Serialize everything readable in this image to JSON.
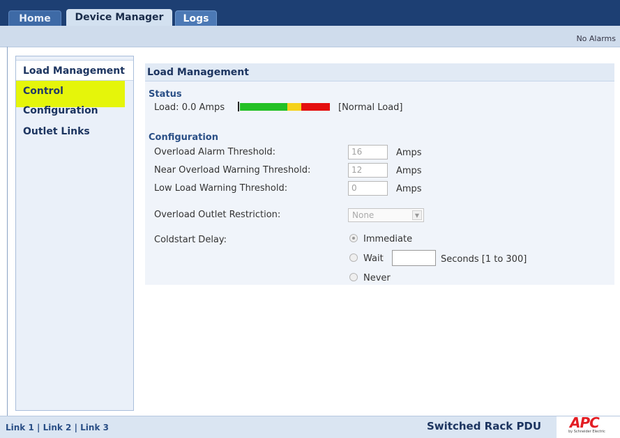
{
  "tabs": [
    {
      "label": "Home"
    },
    {
      "label": "Device Manager",
      "active": true
    },
    {
      "label": "Logs"
    }
  ],
  "alarm_status": "No Alarms",
  "sidebar": {
    "items": [
      {
        "label": "Load Management",
        "selected": true
      },
      {
        "label": "Control",
        "highlighted": true
      },
      {
        "label": "Configuration"
      },
      {
        "label": "Outlet Links"
      }
    ]
  },
  "content": {
    "title": "Load Management",
    "status": {
      "heading": "Status",
      "load_label": "Load: 0.0 Amps",
      "load_state": "[Normal Load]"
    },
    "configuration": {
      "heading": "Configuration",
      "overload_alarm": {
        "label": "Overload Alarm Threshold:",
        "value": "16",
        "unit": "Amps"
      },
      "near_overload": {
        "label": "Near Overload Warning Threshold:",
        "value": "12",
        "unit": "Amps"
      },
      "low_load": {
        "label": "Low Load Warning Threshold:",
        "value": "0",
        "unit": "Amps"
      },
      "outlet_restriction": {
        "label": "Overload Outlet Restriction:",
        "value": "None"
      },
      "coldstart": {
        "label": "Coldstart Delay:",
        "options": [
          "Immediate",
          "Wait",
          "Never"
        ],
        "selected": "Immediate",
        "wait_suffix": "Seconds [1 to 300]"
      }
    }
  },
  "footer": {
    "links": [
      "Link 1",
      "Link 2",
      "Link 3"
    ],
    "separator": "|",
    "product": "Switched Rack PDU",
    "logo": "APC",
    "logo_sub": "by Schneider Electric"
  },
  "colors": {
    "topbar": "#1d3f73",
    "highlight": "#e5f50a",
    "bar_green": "#23c024",
    "bar_yellow": "#f5d21b",
    "bar_red": "#e40f0f",
    "logo_red": "#e31e24"
  }
}
